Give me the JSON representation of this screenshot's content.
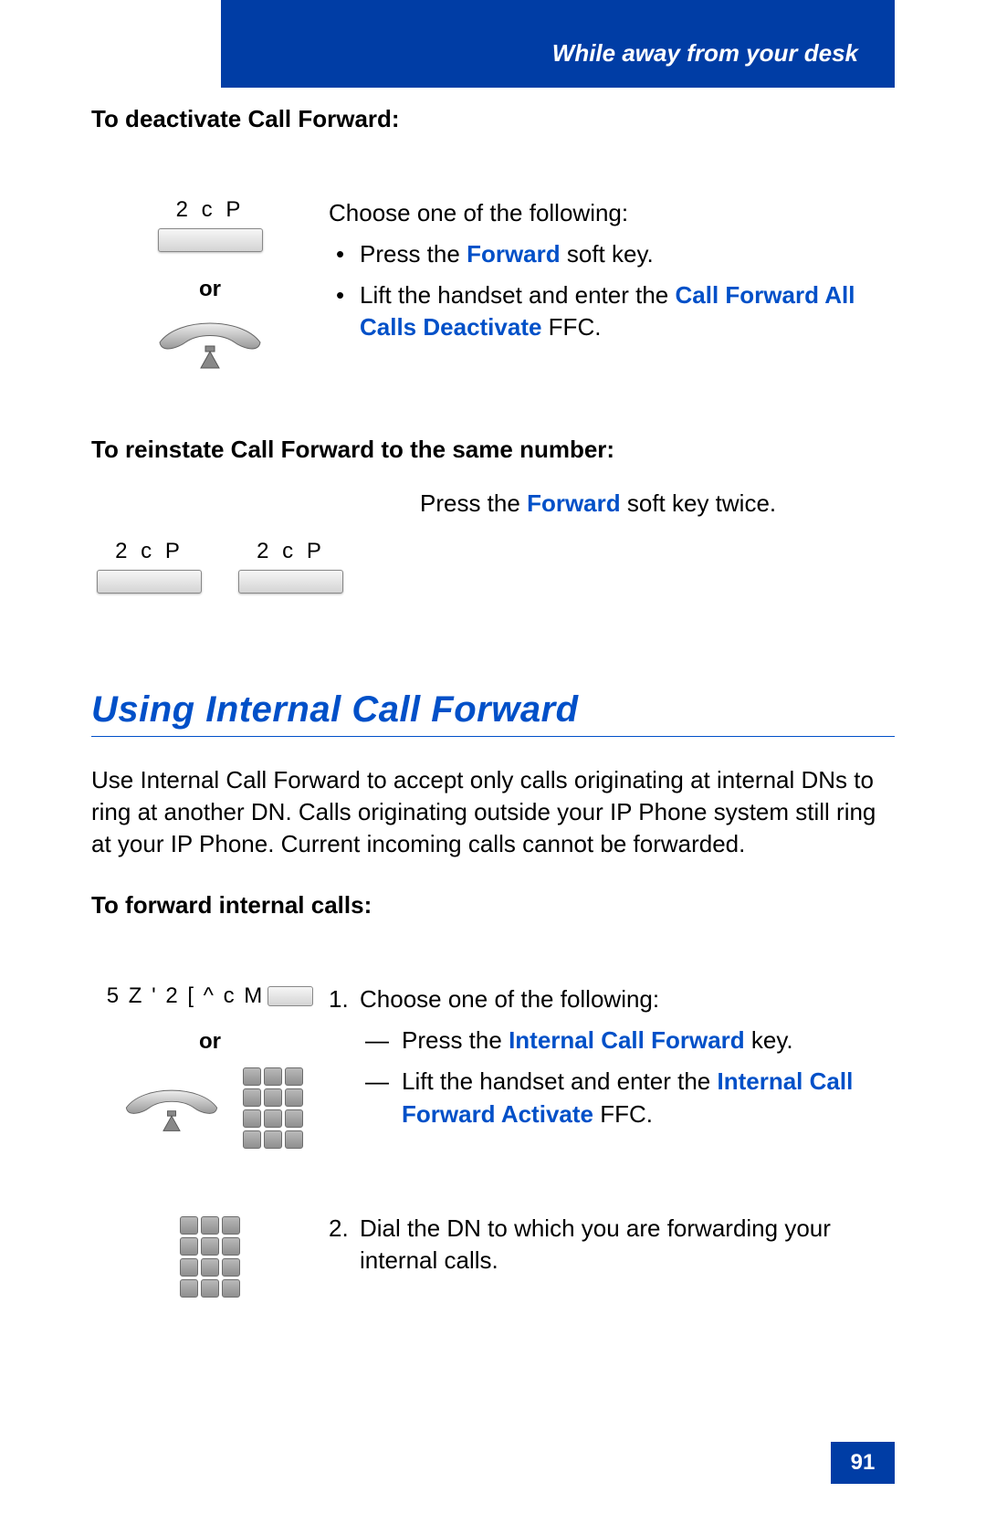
{
  "header": {
    "title": "While away from your desk"
  },
  "s1": {
    "heading": "To deactivate Call Forward:",
    "keyLabel": "2 c P",
    "or": "or",
    "intro": "Choose one of the following:",
    "b1_pre": "Press the ",
    "b1_link": "Forward",
    "b1_post": " soft key.",
    "b2_pre": "Lift the handset and enter the ",
    "b2_link": "Call Forward All Calls Deactivate",
    "b2_post": " FFC."
  },
  "s2": {
    "heading": "To reinstate Call Forward to the same number:",
    "keyLabel1": "2 c P",
    "keyLabel2": "2 c P",
    "text_pre": "Press the ",
    "text_link": "Forward",
    "text_post": " soft key twice."
  },
  "s3": {
    "title": "Using Internal Call Forward",
    "para": "Use Internal Call Forward to accept only calls originating at internal DNs to ring at another DN. Calls originating outside your IP Phone system still ring at your IP Phone. Current incoming calls cannot be forwarded.",
    "heading": "To forward internal calls:",
    "keyLabel": "5 Z ' 2 [ ^ c M",
    "or": "or",
    "step1_num": "1.",
    "step1_intro": "Choose one of the following:",
    "step1_a_pre": "Press the ",
    "step1_a_link": "Internal Call Forward",
    "step1_a_post": " key.",
    "step1_b_pre": "Lift the handset and enter the ",
    "step1_b_link": "Internal Call Forward Activate",
    "step1_b_post": " FFC.",
    "step2_num": "2.",
    "step2_text": "Dial the DN to which you are forwarding your internal calls."
  },
  "pageNumber": "91"
}
